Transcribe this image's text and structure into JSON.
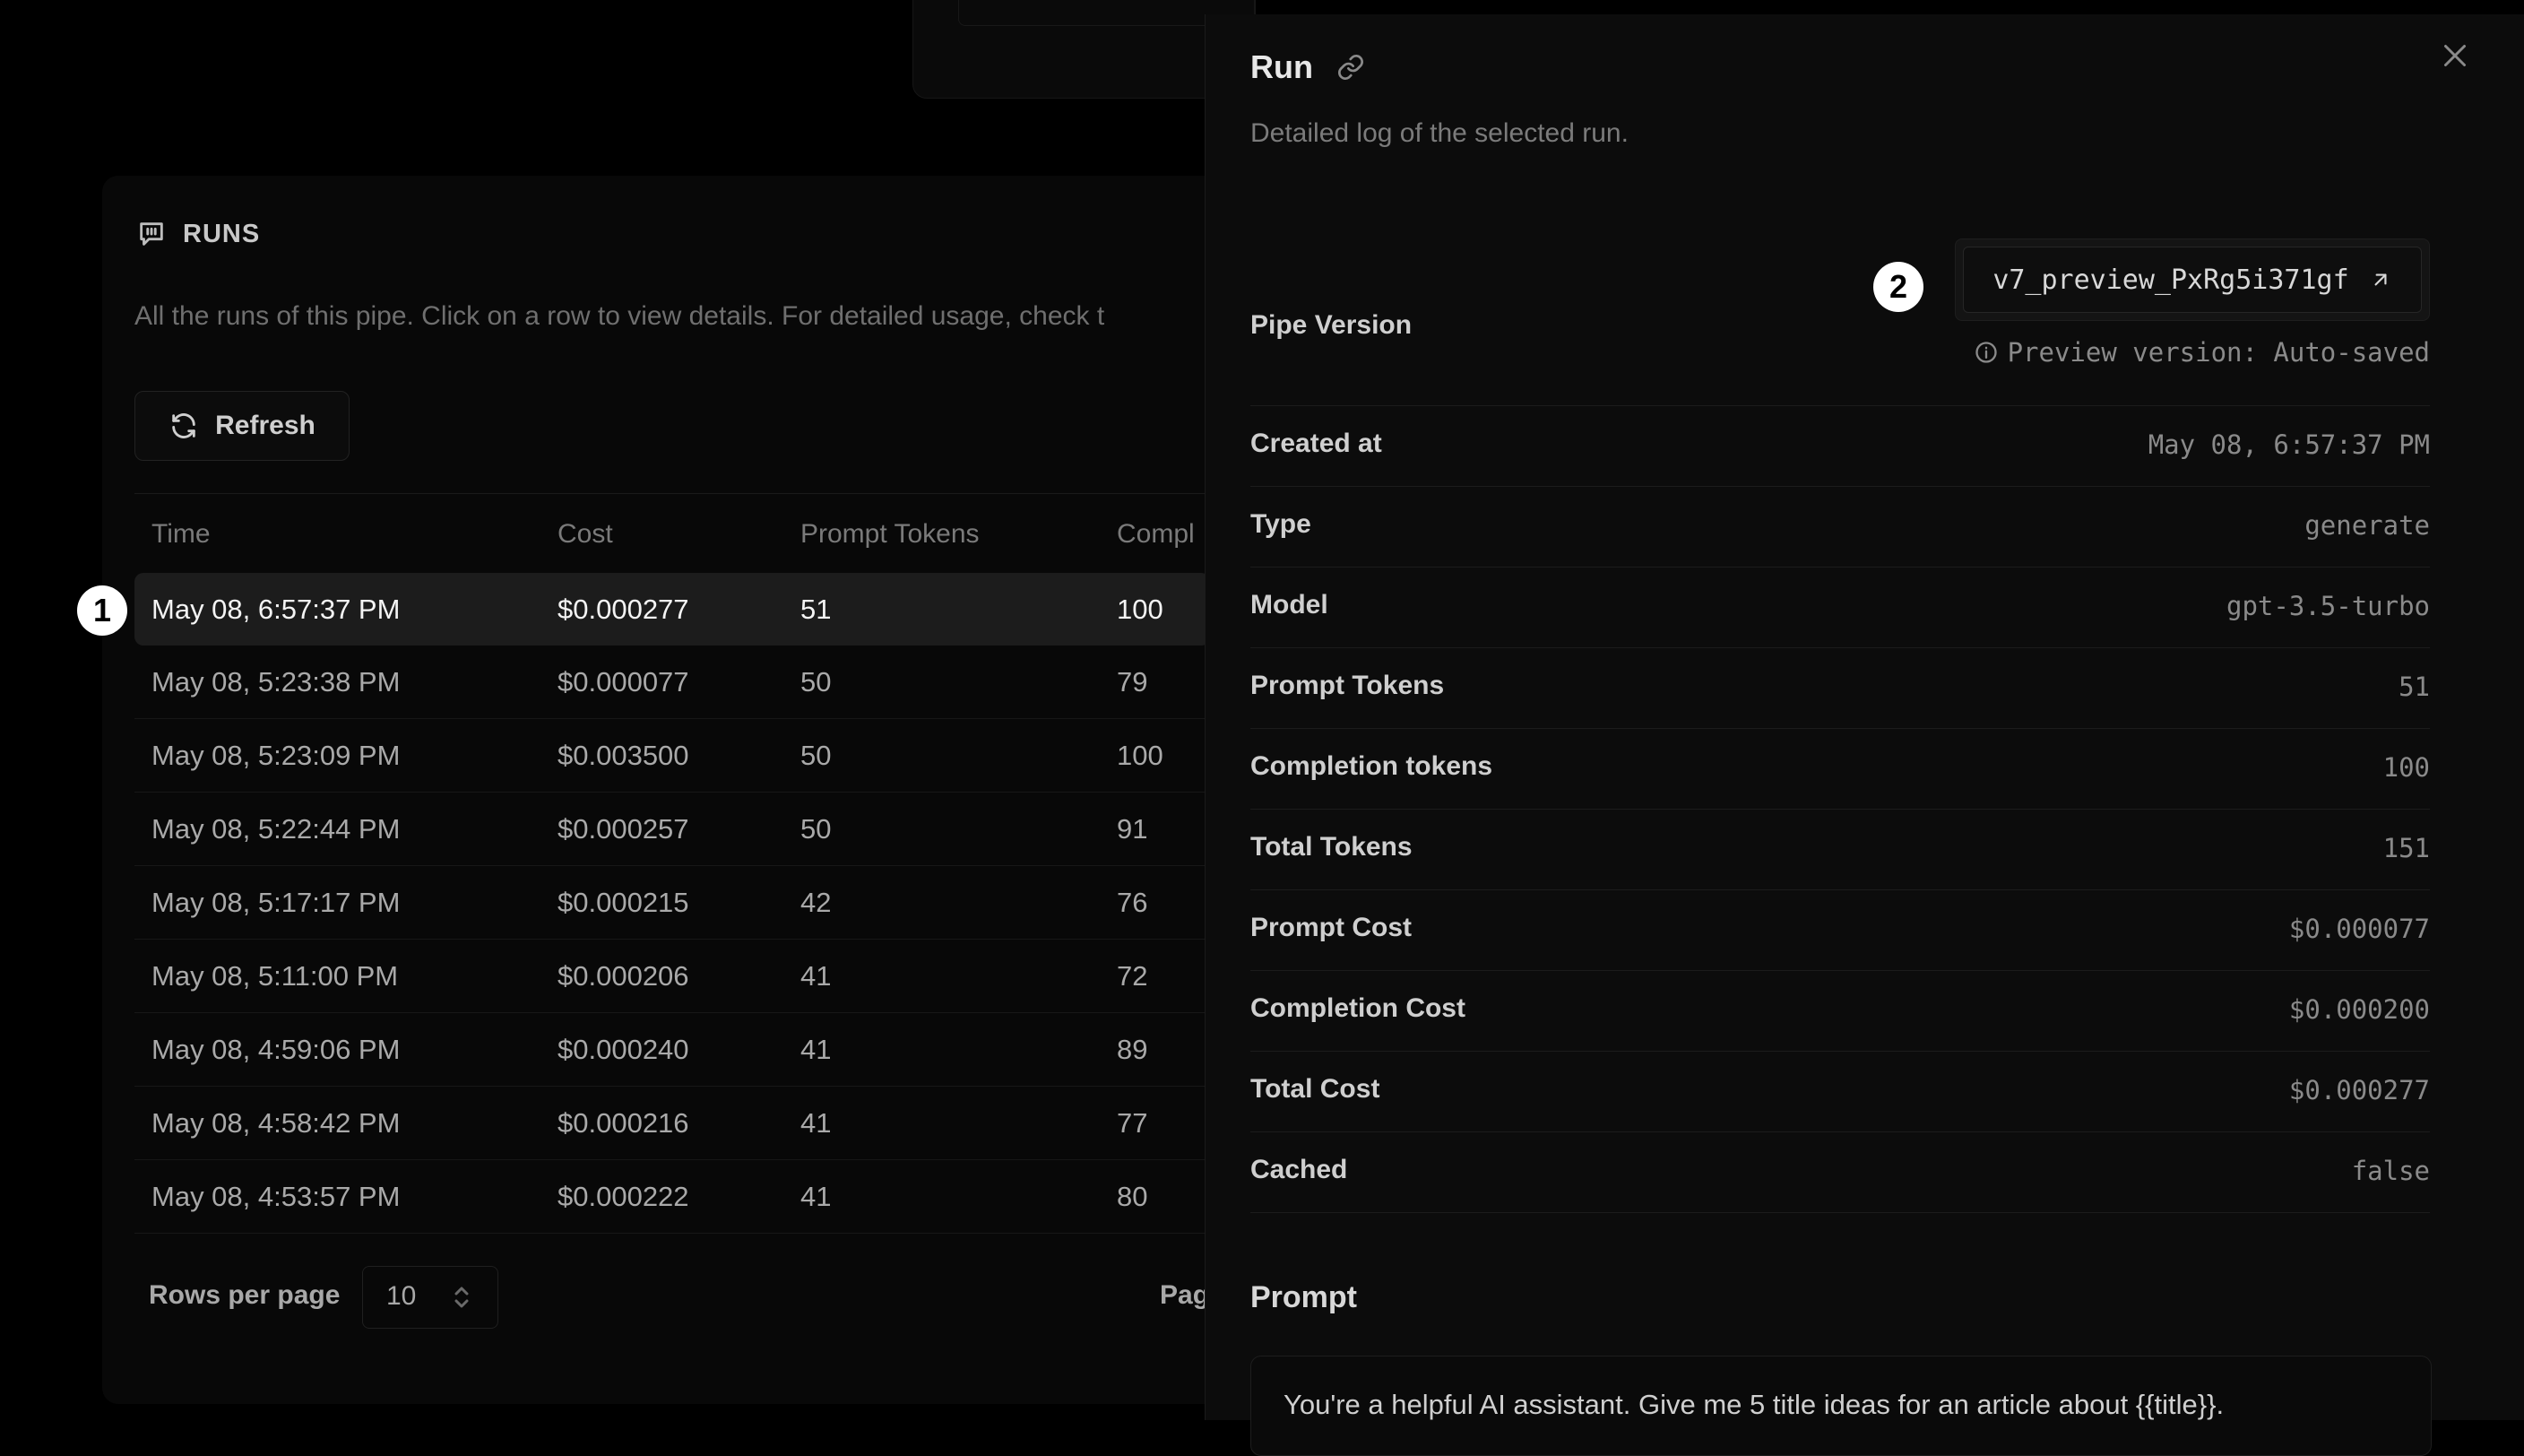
{
  "runs": {
    "title": "RUNS",
    "description": "All the runs of this pipe. Click on a row to view details. For detailed usage, check t",
    "refresh_label": "Refresh",
    "columns": [
      "Time",
      "Cost",
      "Prompt Tokens",
      "Compl"
    ],
    "rows": [
      {
        "time": "May 08, 6:57:37 PM",
        "cost": "$0.000277",
        "prompt_tokens": "51",
        "completion": "100"
      },
      {
        "time": "May 08, 5:23:38 PM",
        "cost": "$0.000077",
        "prompt_tokens": "50",
        "completion": "79"
      },
      {
        "time": "May 08, 5:23:09 PM",
        "cost": "$0.003500",
        "prompt_tokens": "50",
        "completion": "100"
      },
      {
        "time": "May 08, 5:22:44 PM",
        "cost": "$0.000257",
        "prompt_tokens": "50",
        "completion": "91"
      },
      {
        "time": "May 08, 5:17:17 PM",
        "cost": "$0.000215",
        "prompt_tokens": "42",
        "completion": "76"
      },
      {
        "time": "May 08, 5:11:00 PM",
        "cost": "$0.000206",
        "prompt_tokens": "41",
        "completion": "72"
      },
      {
        "time": "May 08, 4:59:06 PM",
        "cost": "$0.000240",
        "prompt_tokens": "41",
        "completion": "89"
      },
      {
        "time": "May 08, 4:58:42 PM",
        "cost": "$0.000216",
        "prompt_tokens": "41",
        "completion": "77"
      },
      {
        "time": "May 08, 4:53:57 PM",
        "cost": "$0.000222",
        "prompt_tokens": "41",
        "completion": "80"
      }
    ],
    "rows_per_page_label": "Rows per page",
    "rows_per_page_value": "10",
    "page_label": "Pag"
  },
  "badges": {
    "first": "1",
    "second": "2"
  },
  "drawer": {
    "title": "Run",
    "description": "Detailed log of the selected run.",
    "pipe_version_label": "Pipe Version",
    "pipe_version_value": "v7_preview_PxRg5i371gf",
    "pipe_version_note": "Preview version: Auto-saved",
    "fields": [
      {
        "label": "Created at",
        "value": "May 08, 6:57:37 PM"
      },
      {
        "label": "Type",
        "value": "generate"
      },
      {
        "label": "Model",
        "value": "gpt-3.5-turbo"
      },
      {
        "label": "Prompt Tokens",
        "value": "51"
      },
      {
        "label": "Completion tokens",
        "value": "100"
      },
      {
        "label": "Total Tokens",
        "value": "151"
      },
      {
        "label": "Prompt Cost",
        "value": "$0.000077"
      },
      {
        "label": "Completion Cost",
        "value": "$0.000200"
      },
      {
        "label": "Total Cost",
        "value": "$0.000277"
      },
      {
        "label": "Cached",
        "value": "false"
      }
    ],
    "prompt_title": "Prompt",
    "prompt_text": "You're a helpful AI assistant. Give me 5 title ideas for an article about {{title}}."
  },
  "icons": {
    "runs": "runs-chat-icon",
    "refresh": "refresh-icon",
    "link": "link-icon",
    "close": "close-icon",
    "external": "external-arrow-icon",
    "info": "info-icon",
    "select": "chevron-up-down-icon"
  }
}
